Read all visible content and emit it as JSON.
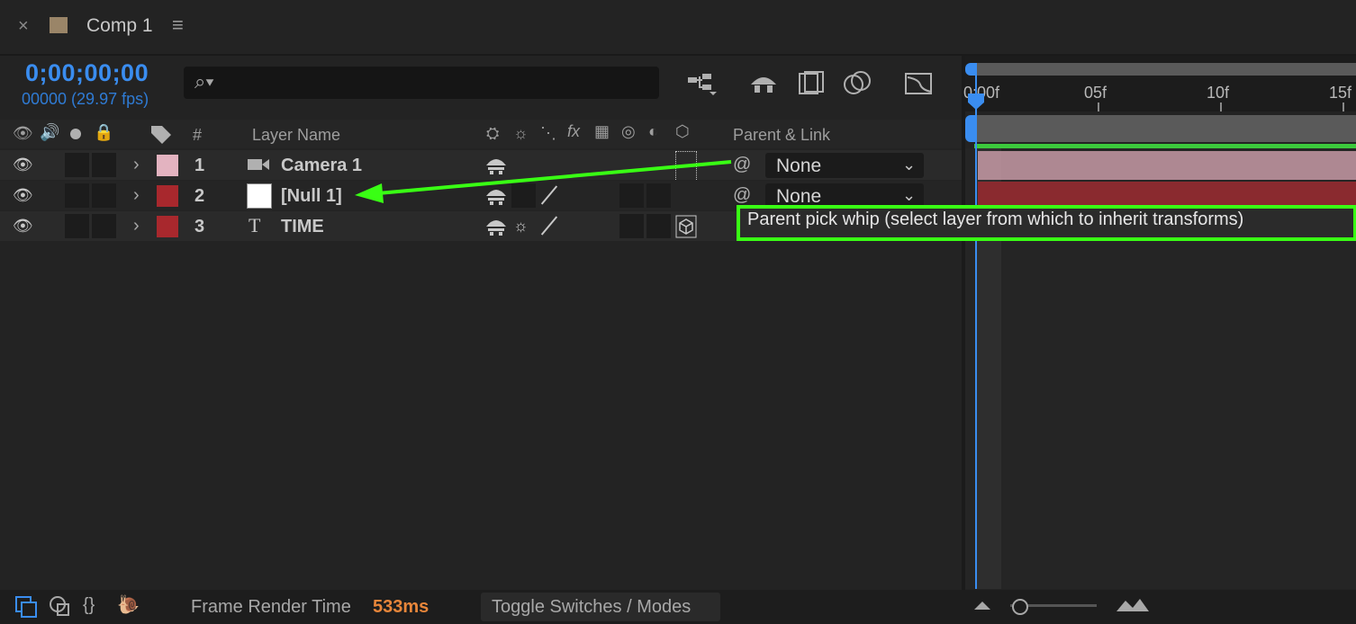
{
  "tab": {
    "close": "×",
    "title": "Comp 1",
    "menu": "≡"
  },
  "timecode": {
    "value": "0;00;00;00",
    "frames_fps": "00000 (29.97 fps)"
  },
  "search": {
    "placeholder": "",
    "icon": "search-icon"
  },
  "toolbar": {
    "icons": [
      "composition-mini-flowchart-icon",
      "draft-3d-icon",
      "frame-blending-icon",
      "motion-blur-icon",
      "graph-editor-icon"
    ]
  },
  "columns": {
    "hash": "#",
    "layer_name": "Layer Name",
    "parent_link": "Parent & Link",
    "fx": "fx"
  },
  "layers": [
    {
      "index": "1",
      "name": "Camera 1",
      "parent": "None",
      "label_color": "#e3b3c0"
    },
    {
      "index": "2",
      "name": "[Null 1]",
      "parent": "None",
      "label_color": "#a8282d"
    },
    {
      "index": "3",
      "name": "TIME",
      "parent": "",
      "label_color": "#a8282d"
    }
  ],
  "tooltip": {
    "text": "Parent pick whip (select layer from which to inherit transforms)"
  },
  "timeline": {
    "ticks": [
      "0:00f",
      "05f",
      "10f",
      "15f"
    ]
  },
  "status": {
    "frame_render_label": "Frame Render Time",
    "frame_render_value": "533ms",
    "toggle_label": "Toggle Switches / Modes"
  },
  "colors": {
    "accent": "#3a8df0",
    "highlight": "#39ff14",
    "render_time": "#e8863a"
  }
}
